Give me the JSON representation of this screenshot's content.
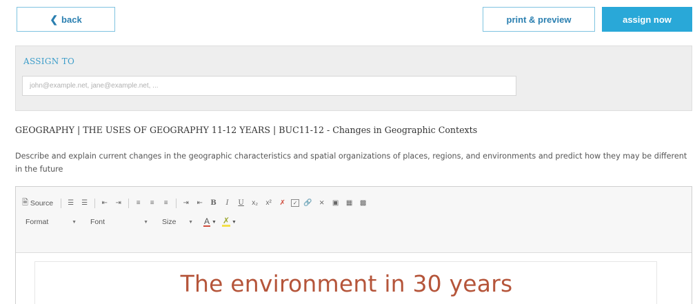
{
  "header": {
    "back_label": "back",
    "print_label": "print & preview",
    "assign_label": "assign now"
  },
  "assign": {
    "label": "ASSIGN TO",
    "placeholder": "john@example.net, jane@example.net, ..."
  },
  "standard": {
    "title": "GEOGRAPHY | THE USES OF GEOGRAPHY 11-12 YEARS | BUC11-12 - Changes in Geographic Contexts",
    "description": "Describe and explain current changes in the geographic characteristics and spatial organizations of places, regions, and environments and predict how they may be different in the future"
  },
  "editor": {
    "toolbar": {
      "source_label": "Source",
      "format_label": "Format",
      "font_label": "Font",
      "size_label": "Size"
    },
    "content_heading": "The environment in 30 years"
  },
  "colors": {
    "accent": "#29a8d8",
    "heading": "#b5553a"
  }
}
